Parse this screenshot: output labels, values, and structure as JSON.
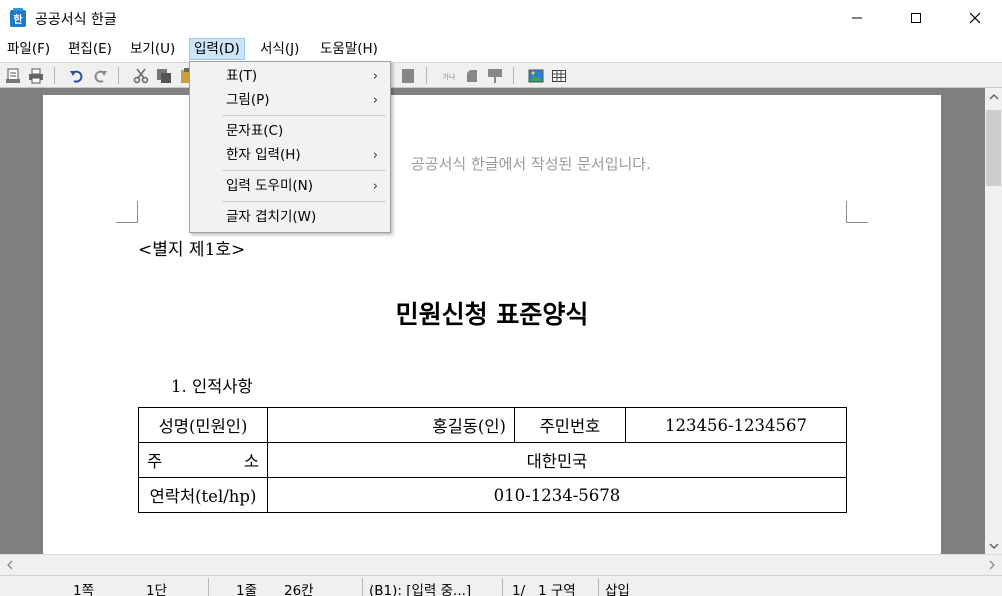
{
  "window": {
    "title": "공공서식 한글",
    "icon": "hwp-app-icon"
  },
  "menubar": {
    "items": [
      {
        "label": "파일(F)"
      },
      {
        "label": "편집(E)"
      },
      {
        "label": "보기(U)"
      },
      {
        "label": "입력(D)",
        "active": true
      },
      {
        "label": "서식(J)"
      },
      {
        "label": "도움말(H)"
      }
    ]
  },
  "dropdown": {
    "items": [
      {
        "label": "표(T)",
        "submenu": true
      },
      {
        "label": "그림(P)",
        "submenu": true
      },
      {
        "label": "문자표(C)",
        "submenu": false
      },
      {
        "label": "한자 입력(H)",
        "submenu": true
      },
      {
        "label": "입력 도우미(N)",
        "submenu": true
      },
      {
        "label": "글자 겹치기(W)",
        "submenu": false
      }
    ],
    "arrow": "›"
  },
  "document": {
    "header_note": "공공서식 한글에서 작성된 문서입니다.",
    "annex": "<별지 제1호>",
    "title": "민원신청 표준양식",
    "section": "1. 인적사항",
    "table": {
      "row1": {
        "label": "성명(민원인)",
        "name_value": "홍길동(인)",
        "id_label": "주민번호",
        "id_value": "123456-1234567"
      },
      "row2": {
        "label_a": "주",
        "label_b": "소",
        "value": "대한민국"
      },
      "row3": {
        "label": "연락처(tel/hp)",
        "value": "010-1234-5678"
      }
    }
  },
  "statusbar": {
    "page": "1쪽",
    "column": "1단",
    "line": "1줄",
    "char": "26칸",
    "block": "(B1): [입력 중...]",
    "section": "1/   1 구역",
    "mode": "삽입"
  },
  "colors": {
    "accent": "#cce4f7",
    "doc_background": "#808080",
    "menu_background": "#f2f2f2"
  }
}
